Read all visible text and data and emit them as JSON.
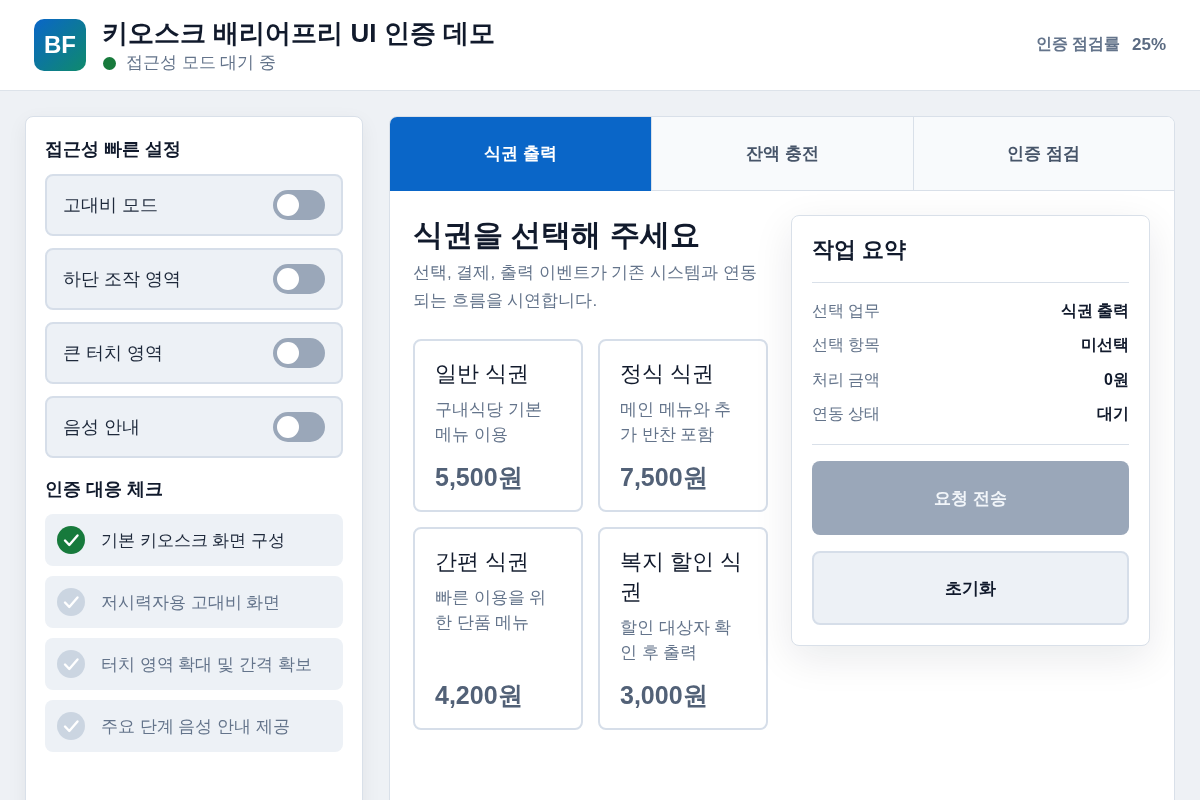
{
  "header": {
    "logo": "BF",
    "title": "키오스크 배리어프리 UI 인증 데모",
    "status": "접근성 모드 대기 중",
    "progress_label": "인증 점검률",
    "progress_value": "25%"
  },
  "quick_settings": {
    "title": "접근성 빠른 설정",
    "items": [
      {
        "label": "고대비 모드",
        "on": false
      },
      {
        "label": "하단 조작 영역",
        "on": false
      },
      {
        "label": "큰 터치 영역",
        "on": false
      },
      {
        "label": "음성 안내",
        "on": false
      }
    ]
  },
  "checklist": {
    "title": "인증 대응 체크",
    "items": [
      {
        "label": "기본 키오스크 화면 구성",
        "checked": true
      },
      {
        "label": "저시력자용 고대비 화면",
        "checked": false
      },
      {
        "label": "터치 영역 확대 및 간격 확보",
        "checked": false
      },
      {
        "label": "주요 단계 음성 안내 제공",
        "checked": false
      }
    ]
  },
  "tabs": [
    {
      "label": "식권 출력",
      "selected": true
    },
    {
      "label": "잔액 충전",
      "selected": false
    },
    {
      "label": "인증 점검",
      "selected": false
    }
  ],
  "content": {
    "title": "식권을 선택해 주세요",
    "description": "선택, 결제, 출력 이벤트가 기존 시스템과 연동되는 흐름을 시연합니다.",
    "tickets": [
      {
        "name": "일반 식권",
        "description": "구내식당 기본 메뉴 이용",
        "price": "5,500원",
        "selected": false
      },
      {
        "name": "정식 식권",
        "description": "메인 메뉴와 추가 반찬 포함",
        "price": "7,500원",
        "selected": false
      },
      {
        "name": "간편 식권",
        "description": "빠른 이용을 위한 단품 메뉴",
        "price": "4,200원",
        "selected": false
      },
      {
        "name": "복지 할인 식권",
        "description": "할인 대상자 확인 후 출력",
        "price": "3,000원",
        "selected": false
      }
    ]
  },
  "summary": {
    "title": "작업 요약",
    "rows": [
      {
        "label": "선택 업무",
        "value": "식권 출력"
      },
      {
        "label": "선택 항목",
        "value": "미선택"
      },
      {
        "label": "처리 금액",
        "value": "0원"
      },
      {
        "label": "연동 상태",
        "value": "대기"
      }
    ],
    "buttons": [
      {
        "label": "요청 전송",
        "kind": "primary",
        "disabled": true
      },
      {
        "label": "초기화",
        "kind": "secondary",
        "disabled": false
      }
    ]
  }
}
